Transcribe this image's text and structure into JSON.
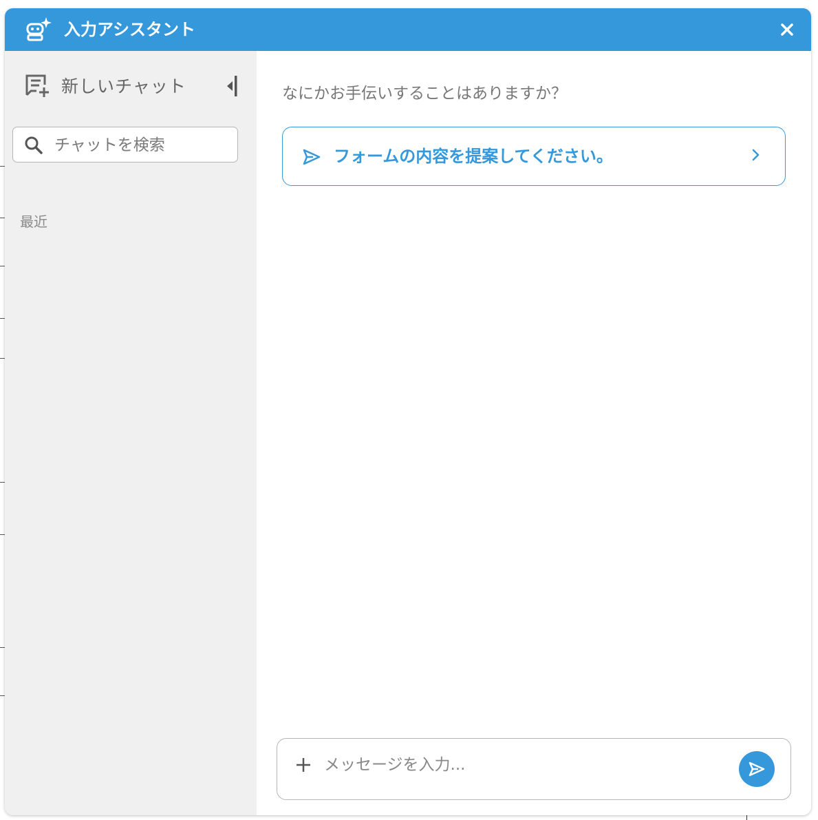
{
  "header": {
    "title": "入力アシスタント",
    "icon": "robot-sparkle-icon",
    "close_icon": "close-icon"
  },
  "sidebar": {
    "new_chat_label": "新しいチャット",
    "new_chat_icon": "new-chat-icon",
    "collapse_icon": "collapse-sidebar-icon",
    "search": {
      "placeholder": "チャットを検索",
      "value": ""
    },
    "recent_label": "最近"
  },
  "main": {
    "greeting": "なにかお手伝いすることはありますか？",
    "suggestions": [
      {
        "label": "フォームの内容を提案してください。"
      }
    ],
    "composer": {
      "placeholder": "メッセージを入力...",
      "value": ""
    }
  },
  "colors": {
    "accent": "#3498db",
    "sidebar_bg": "#f0f0f0",
    "muted_text": "#777777"
  }
}
